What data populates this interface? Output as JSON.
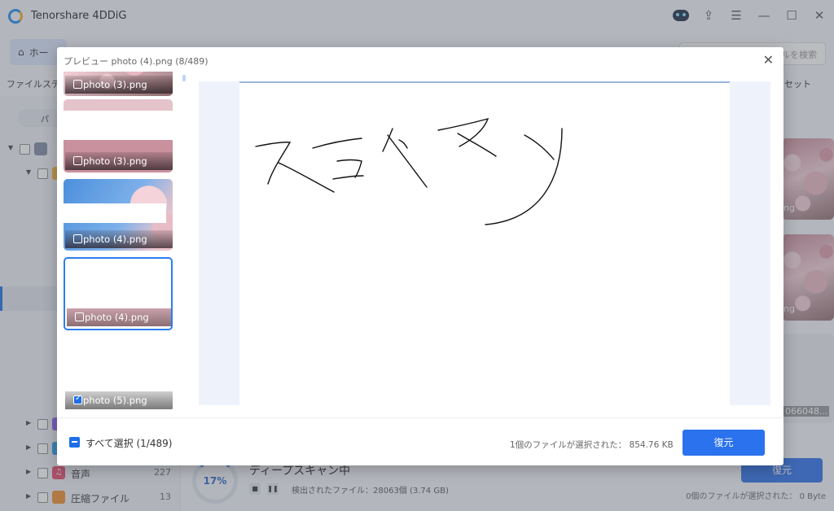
{
  "app": {
    "title": "Tenorshare 4DDiG",
    "home_label": "ホー",
    "search_placeholder": "ァイルを検索",
    "tab_left": "ファイルステ",
    "tab_right": "セット",
    "path_pill": "パ"
  },
  "sidebar": {
    "items": [
      {
        "label": "",
        "count": ""
      },
      {
        "label": "",
        "count": ""
      },
      {
        "label": "",
        "count": ""
      },
      {
        "label": "",
        "count": ""
      },
      {
        "label": "音声",
        "count": "227"
      },
      {
        "label": "圧縮ファイル",
        "count": "13"
      }
    ]
  },
  "right_thumbs": [
    {
      "caption": "ng"
    },
    {
      "caption": "ng"
    },
    {
      "caption": "066048..."
    }
  ],
  "scan": {
    "progress": "17%",
    "title": "ディープスキャン中",
    "found": "検出されたファイル：28063個 (3.74 GB)",
    "restore_label": "復元",
    "selected_info": "0個のファイルが選択された：  0 Byte"
  },
  "modal": {
    "title": "プレビュー photo (4).png (8/489)",
    "thumbs": [
      {
        "name": "photo (3).png",
        "checked": false
      },
      {
        "name": "photo (3).png",
        "checked": false
      },
      {
        "name": "photo (4).png",
        "checked": false
      },
      {
        "name": "photo (4).png",
        "checked": false
      },
      {
        "name": "photo (5).png",
        "checked": true
      }
    ],
    "select_all": "すべて選択 (1/489)",
    "selected_info": "1個のファイルが選択された：  854.76 KB",
    "restore_label": "復元"
  },
  "icons": {
    "close": "close-icon",
    "home": "home-icon",
    "minimize": "minimize-icon",
    "maximize": "maximize-icon",
    "share": "share-icon",
    "menu": "menu-icon",
    "robot": "robot-icon"
  },
  "colors": {
    "accent": "#2a72ee",
    "overlay": "#5a5f69"
  }
}
